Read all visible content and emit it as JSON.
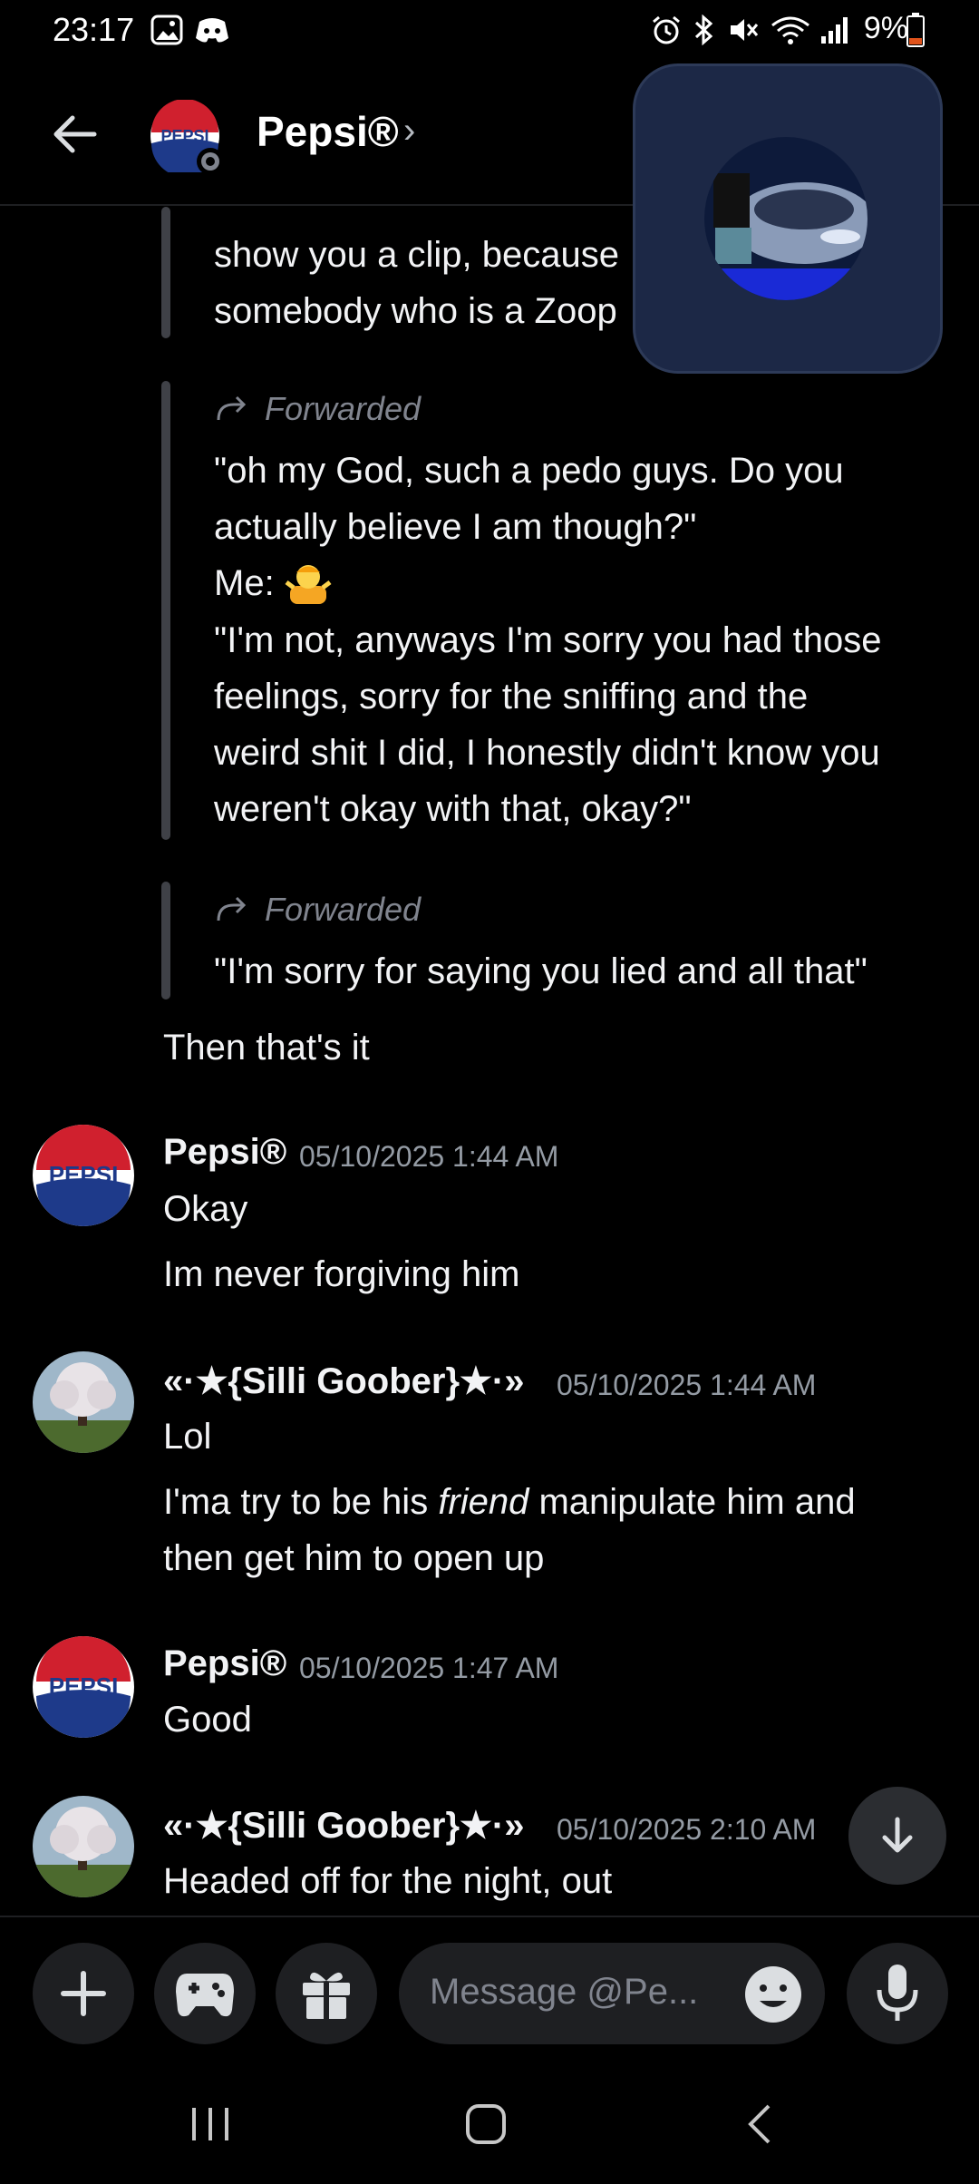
{
  "status_bar": {
    "time": "23:17",
    "battery": "9%"
  },
  "header": {
    "title": "Pepsi®",
    "chevron": "›",
    "avatar_brand": "PEPSI"
  },
  "messages_top": {
    "fwd1_lines": [
      "show you a clip, because",
      "somebody who is a Zoop"
    ],
    "fwd2_label": "Forwarded",
    "fwd2_lines": [
      "\"oh my God, such a pedo guys. Do you",
      "actually believe I am though?\"",
      "Me:",
      "\"I'm not, anyways I'm sorry you had those",
      "feelings, sorry for the sniffing and the",
      "weird shit I did, I honestly didn't know you",
      "weren't okay with that, okay?\""
    ],
    "fwd3_label": "Forwarded",
    "fwd3_line": "\"I'm sorry for saying you lied and all that\"",
    "plain_line": "Then that's it"
  },
  "groups": [
    {
      "user": "Pepsi®",
      "time": "05/10/2025 1:44 AM",
      "lines": [
        "Okay",
        "Im never forgiving him"
      ],
      "avatar": "pepsi-logo"
    },
    {
      "user": "«·★{Silli Goober}★·»",
      "time": "05/10/2025 1:44 AM",
      "line1": "Lol",
      "line2_pre": "I'ma try to be his ",
      "line2_em": "friend",
      "line2_post": " manipulate him and",
      "line3": "then get him to open up",
      "avatar": "tree-photo"
    },
    {
      "user": "Pepsi®",
      "time": "05/10/2025 1:47 AM",
      "lines": [
        "Good"
      ],
      "avatar": "pepsi-logo"
    },
    {
      "user": "«·★{Silli Goober}★·»",
      "time": "05/10/2025 2:10 AM",
      "lines": [
        "Headed off for the night, out"
      ],
      "avatar": "tree-photo"
    }
  ],
  "composer": {
    "placeholder": "Message @Pe..."
  },
  "colors": {
    "background": "#000000",
    "pepsi_blue": "#1e3a8a",
    "pepsi_red": "#d0202e"
  }
}
